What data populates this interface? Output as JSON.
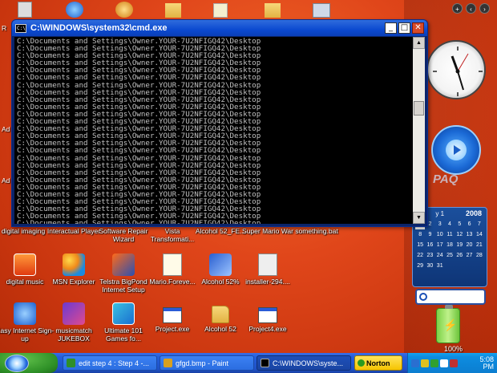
{
  "desktop": {
    "icons": [
      {
        "label": "digital imaging",
        "x": 0
      },
      {
        "label": "Interactual Player"
      },
      {
        "label": "Software Repair Wizard"
      },
      {
        "label": "Vista Transformati..."
      },
      {
        "label": "Alcohol 52_FE..."
      },
      {
        "label": "Super Mario War"
      },
      {
        "label": "something.bat"
      },
      {
        "label": "digital music"
      },
      {
        "label": "MSN Explorer"
      },
      {
        "label": "Telstra BigPond Internet Setup"
      },
      {
        "label": "Mario.Foreve..."
      },
      {
        "label": "Alcohol 52%"
      },
      {
        "label": "installer-294...."
      },
      {
        "label": "Easy Internet Sign-up"
      },
      {
        "label": "musicmatch JUKEBOX"
      },
      {
        "label": "Ultimate 101 Games fo..."
      },
      {
        "label": "Project.exe"
      },
      {
        "label": "Alcohol 52"
      },
      {
        "label": "Project4.exe"
      }
    ],
    "left_edge_fragments": [
      "R",
      "Ad",
      "Ad"
    ]
  },
  "cmd_window": {
    "title": "C:\\WINDOWS\\system32\\cmd.exe",
    "title_icon": "C:\\",
    "minimize": "_",
    "maximize": "□",
    "close": "✕",
    "console_line": "C:\\Documents and Settings\\Owner.YOUR-7U2NFIGQ42\\Desktop",
    "line_count": 27
  },
  "calendar": {
    "month_label": "y 1",
    "year": "2008",
    "weekdays": [
      "",
      "",
      "",
      "",
      "",
      "",
      ""
    ],
    "days": [
      "",
      "",
      "",
      "",
      "",
      "",
      "",
      "1",
      "2",
      "3",
      "4",
      "5",
      "6",
      "7",
      "8",
      "9",
      "10",
      "11",
      "12",
      "13",
      "14",
      "15",
      "16",
      "17",
      "18",
      "19",
      "20",
      "21",
      "22",
      "23",
      "24",
      "25",
      "26",
      "27",
      "28",
      "29",
      "30",
      "31",
      "",
      "",
      "",
      ""
    ]
  },
  "player": {
    "brand": "PAQ"
  },
  "battery": {
    "percent": "100%"
  },
  "taskbar": {
    "buttons": [
      {
        "label": "edit step 4 : Step 4 -...",
        "color": "#2f8f2a"
      },
      {
        "label": "gfgd.bmp - Paint",
        "color": "#d8a020"
      },
      {
        "label": "C:\\WINDOWS\\syste...",
        "color": "#000000"
      }
    ],
    "norton": "Norton",
    "time": "5:08",
    "ampm": "PM"
  }
}
